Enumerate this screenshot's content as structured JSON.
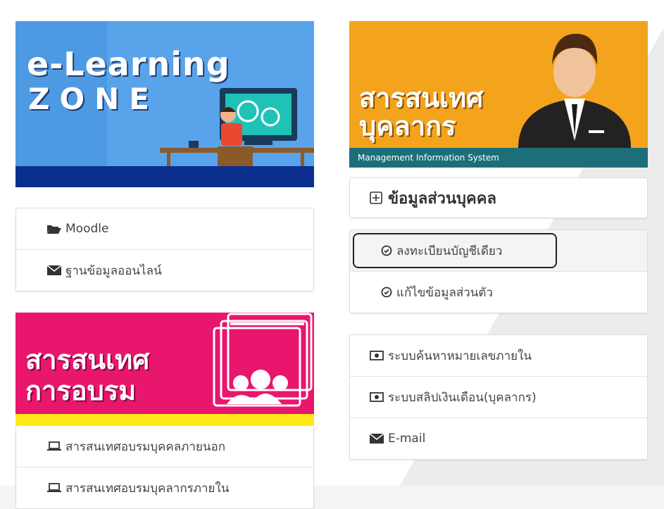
{
  "left": {
    "elearning_banner": {
      "line1": "e-Learning",
      "line2": "ZONE"
    },
    "links1": [
      {
        "label": "Moodle",
        "icon": "folder-open-icon"
      },
      {
        "label": "ฐานข้อมูลออนไลน์",
        "icon": "envelope-icon"
      }
    ],
    "training_banner": {
      "line1": "สารสนเทศ",
      "line2": "การอบรม"
    },
    "links2": [
      {
        "label": "สารสนเทศอบรมบุคคลภายนอก",
        "icon": "laptop-icon"
      },
      {
        "label": "สารสนเทศอบรมบุคลากรภายใน",
        "icon": "laptop-icon"
      }
    ]
  },
  "right": {
    "mis_banner": {
      "line1": "สารสนเทศ",
      "line2": "บุคลากร",
      "footer": "Management Information System"
    },
    "personal_header": "ข้อมูลส่วนบุคคล",
    "personal_links": [
      {
        "label": "ลงทะเบียนบัญชีเดียว",
        "icon": "check-circle-icon"
      },
      {
        "label": "แก้ไขข้อมูลส่วนตัว",
        "icon": "check-circle-icon"
      }
    ],
    "system_links": [
      {
        "label": "ระบบค้นหาหมายเลขภายใน",
        "icon": "money-icon"
      },
      {
        "label": "ระบบสลิปเงินเดือน(บุคลากร)",
        "icon": "money-icon"
      },
      {
        "label": "E-mail",
        "icon": "envelope-icon"
      }
    ]
  },
  "colors": {
    "elearning_bg": "#4d9ae2",
    "elearning_stripe": "#0b2f8f",
    "mis_bg": "#f3a31c",
    "mis_footer": "#1c6f79",
    "training_bg": "#e8166d",
    "training_stripe": "#ffe71a"
  }
}
